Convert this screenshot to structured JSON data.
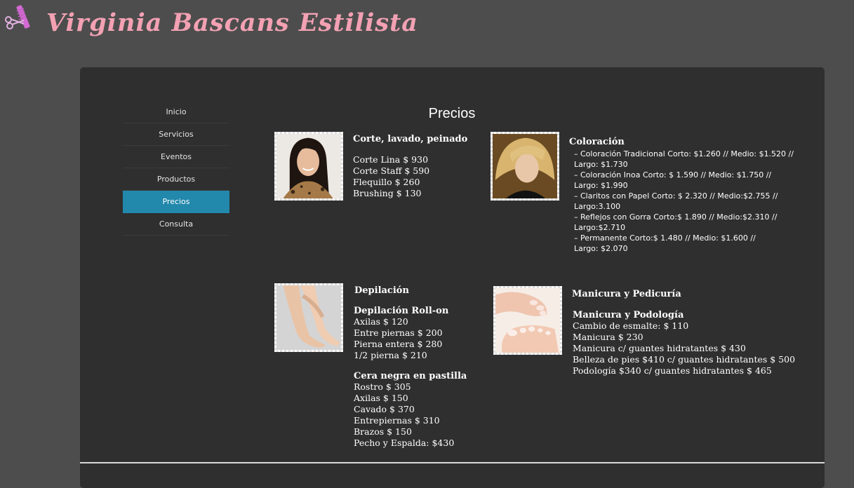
{
  "header": {
    "site_title": "Virginia Bascans Estilista",
    "logo_icon": "comb-scissors-icon"
  },
  "nav": {
    "items": [
      {
        "label": "Inicio"
      },
      {
        "label": "Servicios"
      },
      {
        "label": "Eventos"
      },
      {
        "label": "Productos"
      },
      {
        "label": "Precios",
        "active": true
      },
      {
        "label": "Consulta"
      }
    ],
    "active_color": "#2288ac"
  },
  "main": {
    "page_title": "Precios",
    "corte": {
      "title": "Corte, lavado, peinado",
      "items": [
        "Corte Lina $ 930",
        "Corte Staff $ 590",
        "Flequillo $ 260",
        "Brushing $ 130"
      ]
    },
    "coloracion": {
      "title": "Coloración",
      "lines": [
        "– Coloración Tradicional Corto: $1.260 // Medio: $1.520 //",
        "Largo: $1.730",
        "– Coloración Inoa Corto: $ 1.590 // Medio: $1.750 //",
        "Largo: $1.990",
        "– Claritos con Papel Corto: $ 2.320 // Medio:$2.755 //",
        "Largo:3.100",
        "– Reflejos con Gorra Corto:$ 1.890 // Medio:$2.310 //",
        "Largo:$2.710",
        "– Permanente Corto:$ 1.480 // Medio: $1.600 //",
        "Largo: $2.070"
      ]
    },
    "depilacion": {
      "title": "Depilación",
      "roll_on_title": "Depilación Roll-on",
      "roll_on_items": [
        "Axilas $ 120",
        "Entre piernas $ 200",
        "Pierna entera $ 280",
        "1/2 pierna $ 210"
      ],
      "cera_title": "Cera negra en pastilla",
      "cera_items": [
        "Rostro $ 305",
        "Axilas $ 150",
        "Cavado $ 370",
        "Entrepiernas $ 310",
        "Brazos $ 150",
        "Pecho y Espalda: $430"
      ]
    },
    "manicura": {
      "title": "Manicura y Pedicuría",
      "sub_title": "Manicura y Podología",
      "items": [
        "Cambio de esmalte: $ 110",
        "Manicura $ 230",
        "Manicura c/ guantes hidratantes $ 430",
        "Belleza de pies $410 c/ guantes hidratantes $ 500",
        "Podología $340 c/ guantes hidratantes $ 465"
      ]
    }
  }
}
